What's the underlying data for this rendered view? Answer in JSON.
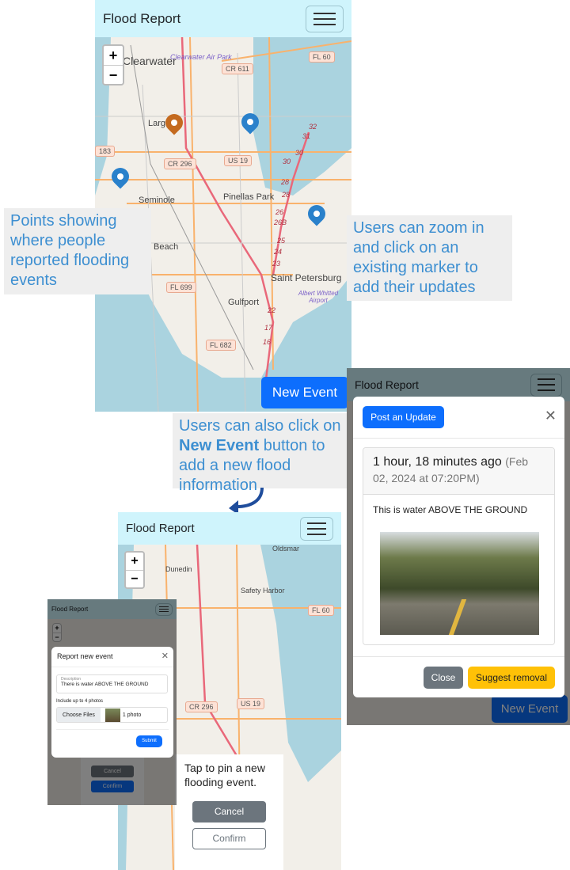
{
  "app": {
    "title": "Flood Report"
  },
  "map": {
    "zoom_in": "+",
    "zoom_out": "−",
    "places": [
      "Clearwater",
      "Clearwater Air Park",
      "Largo",
      "Seminole",
      "Pinellas Park",
      "Beach",
      "Gulfport",
      "Saint Petersburg",
      "Albert Whitted Airport",
      "Dunedin",
      "Safety Harbor",
      "Oldsmar"
    ],
    "shields": [
      "CR 611",
      "FL 60",
      "CR 296",
      "US 19",
      "183",
      "FL 699",
      "FL 682"
    ],
    "interstate_numbers": [
      "32",
      "31",
      "30",
      "30",
      "28",
      "28",
      "26",
      "26B",
      "25",
      "24",
      "23",
      "22",
      "17",
      "16"
    ],
    "markers": [
      {
        "color": "#c46a1f"
      },
      {
        "color": "#2a81cb"
      },
      {
        "color": "#2a81cb"
      },
      {
        "color": "#2a81cb"
      }
    ]
  },
  "new_event_label": "New Event",
  "annotations": {
    "points": "Points showing where people reported flooding events",
    "zoom": "Users can zoom in and click on an existing marker to add their updates",
    "new_event_pre": "Users can also click on ",
    "new_event_bold": "New Event",
    "new_event_post": " button to add a new flood information"
  },
  "pin_sheet": {
    "prompt": "Tap to pin a new flooding event.",
    "cancel": "Cancel",
    "confirm": "Confirm"
  },
  "report_modal": {
    "title": "Report new event",
    "description_label": "Description",
    "description_value": "There is water ABOVE THE GROUND",
    "photos_label": "Include up to 4 photos",
    "choose_files": "Choose Files",
    "file_count": "1 photo",
    "submit": "Submit",
    "bg_cancel": "Cancel",
    "bg_confirm": "Confirm"
  },
  "update_modal": {
    "post_update": "Post an Update",
    "relative_time": "1 hour, 18 minutes ago",
    "absolute_time": "(Feb 02, 2024 at 07:20PM)",
    "text": "This is water ABOVE THE GROUND",
    "close": "Close",
    "suggest_removal": "Suggest removal"
  },
  "colors": {
    "primary": "#0d6efd",
    "navbar": "#cff4fc",
    "warning": "#ffc107",
    "secondary": "#6c757d",
    "annotation_text": "#3d8fd1"
  }
}
